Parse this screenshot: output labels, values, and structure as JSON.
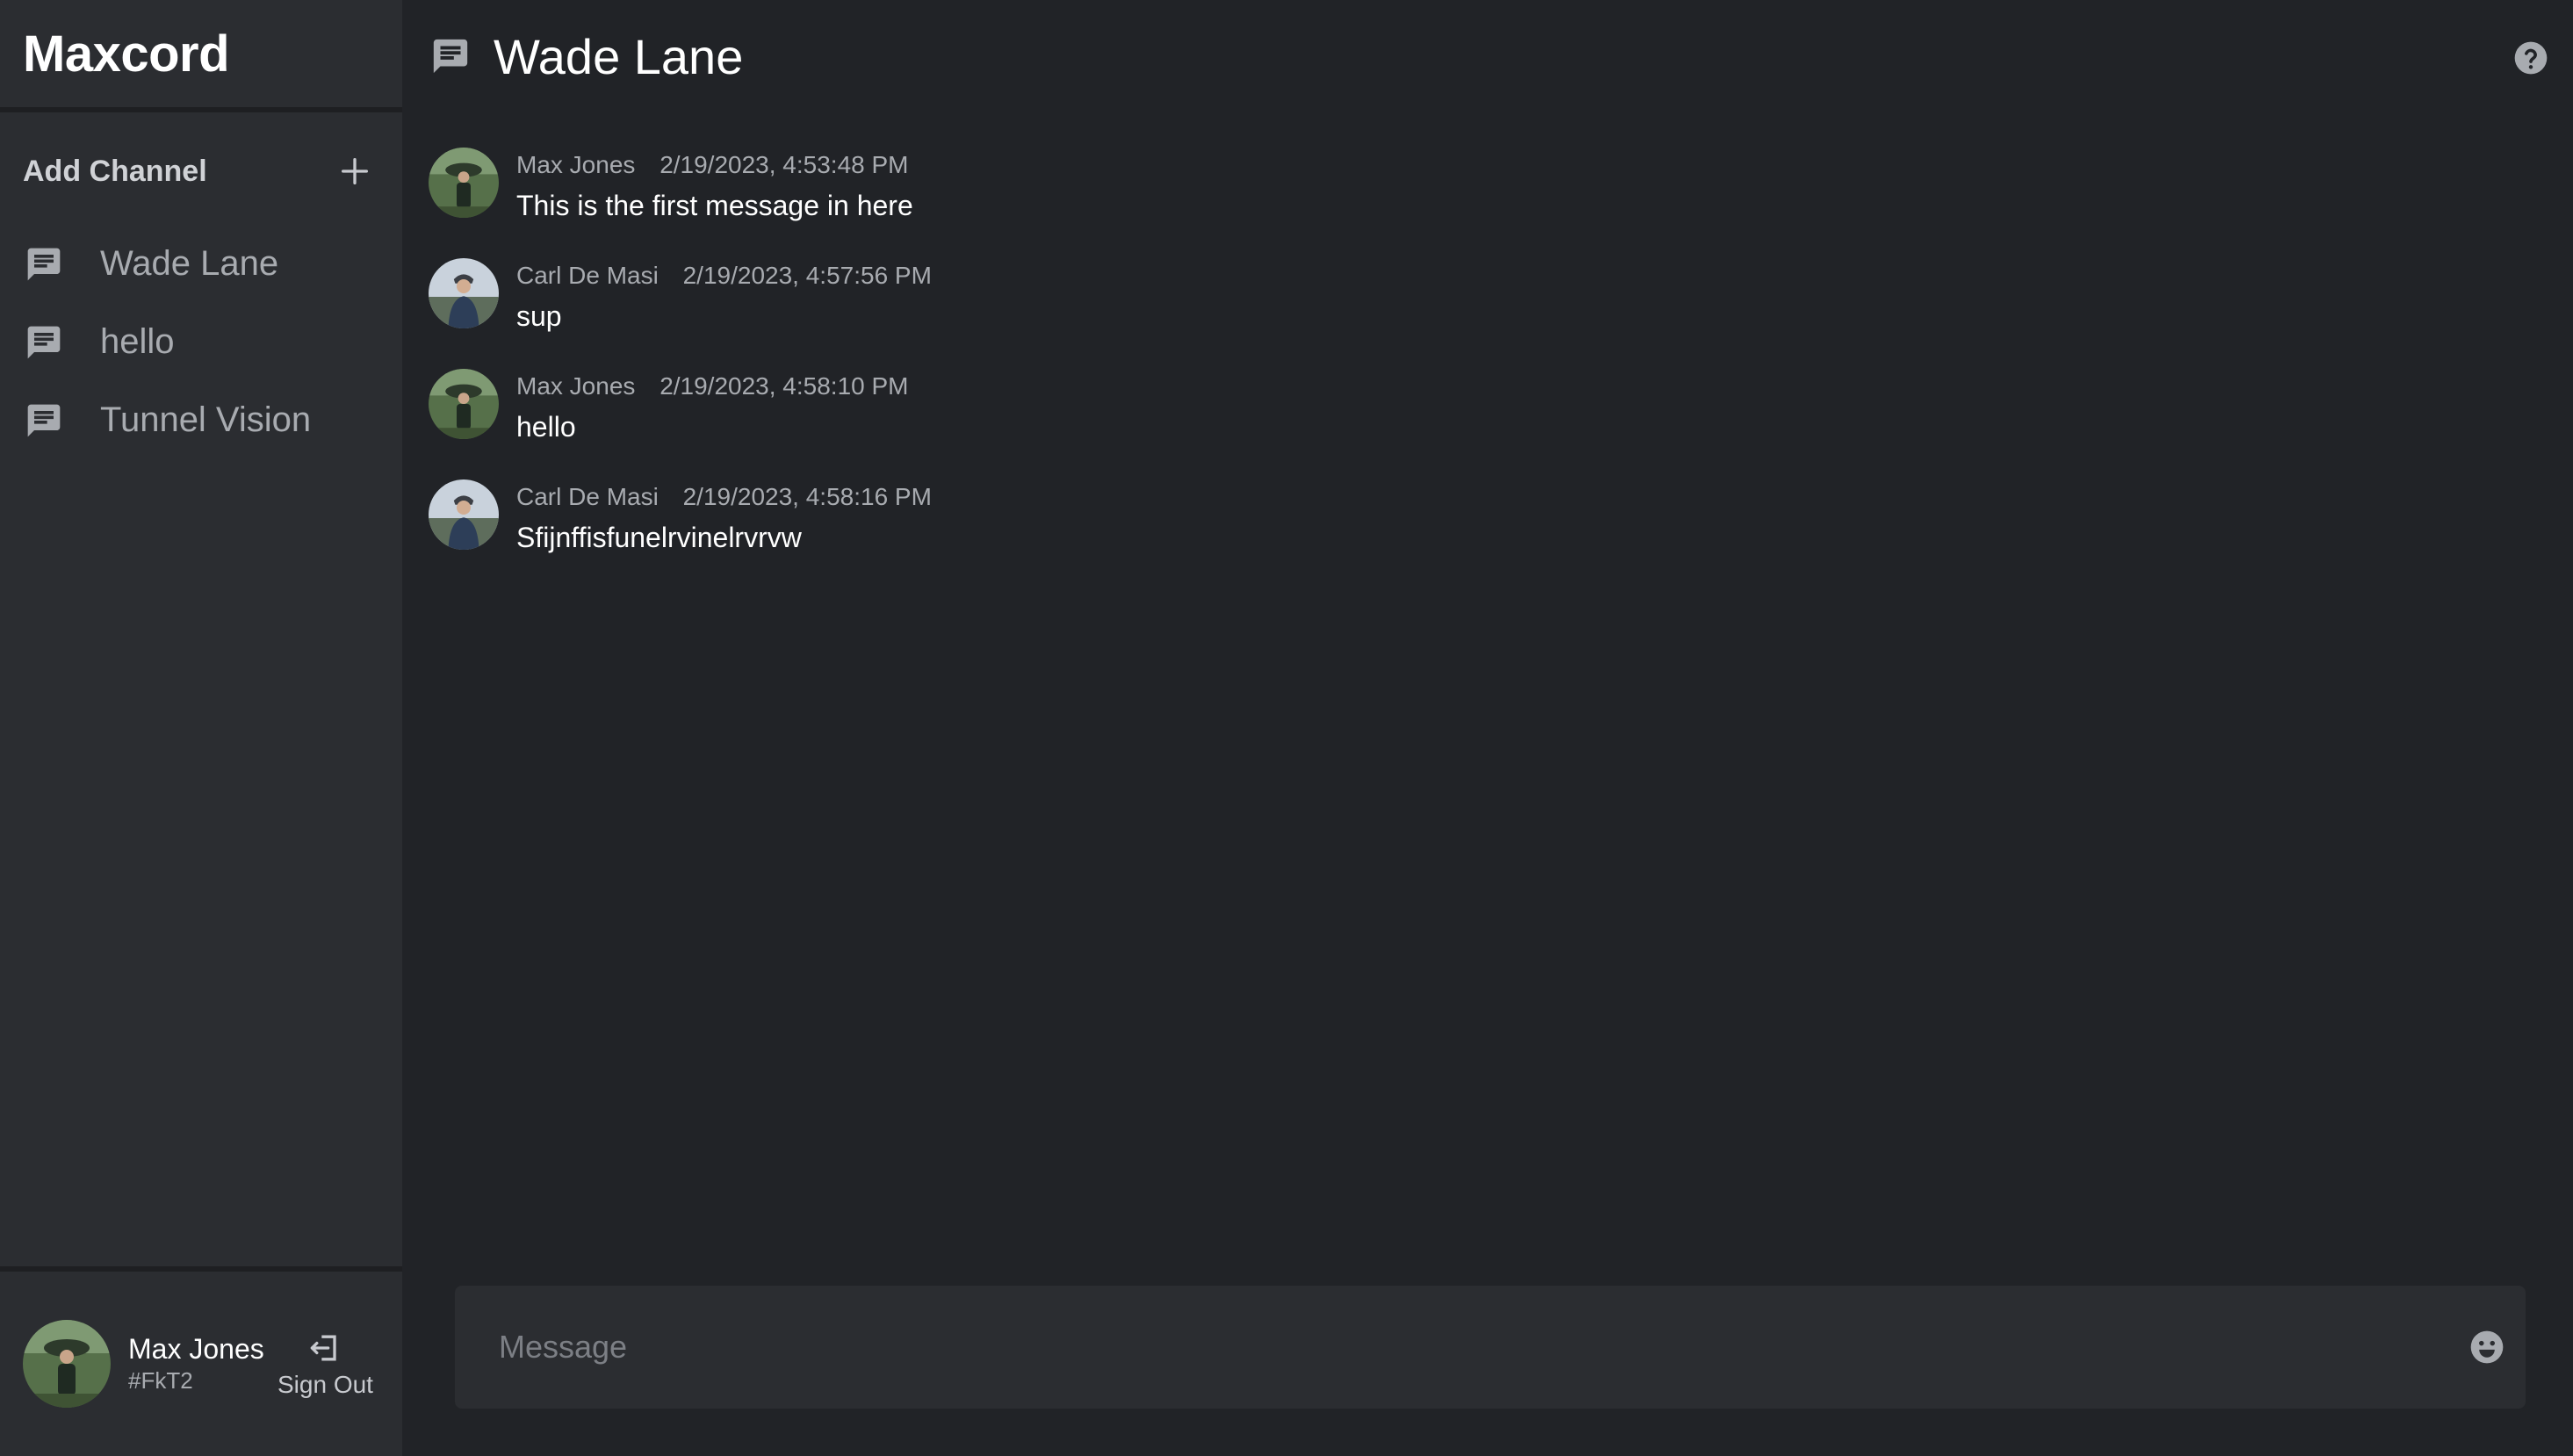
{
  "app": {
    "title": "Maxcord"
  },
  "sidebar": {
    "add_channel_label": "Add Channel",
    "channels": [
      {
        "name": "Wade Lane",
        "icon": "chat-icon"
      },
      {
        "name": "hello",
        "icon": "chat-icon"
      },
      {
        "name": "Tunnel Vision",
        "icon": "chat-icon"
      }
    ]
  },
  "user": {
    "name": "Max Jones",
    "tag": "#FkT2",
    "signout_label": "Sign Out"
  },
  "channel": {
    "title": "Wade Lane"
  },
  "messages": [
    {
      "author": "Max Jones",
      "timestamp": "2/19/2023, 4:53:48 PM",
      "text": "This is the first message in here"
    },
    {
      "author": "Carl De Masi",
      "timestamp": "2/19/2023, 4:57:56 PM",
      "text": "sup"
    },
    {
      "author": "Max Jones",
      "timestamp": "2/19/2023, 4:58:10 PM",
      "text": "hello"
    },
    {
      "author": "Carl De Masi",
      "timestamp": "2/19/2023, 4:58:16 PM",
      "text": "Sfijnffisfunelrvinelrvrvw"
    }
  ],
  "composer": {
    "placeholder": "Message"
  },
  "colors": {
    "sidebar_bg": "#2b2d31",
    "main_bg": "#212327",
    "muted_text": "#a8abb0"
  }
}
